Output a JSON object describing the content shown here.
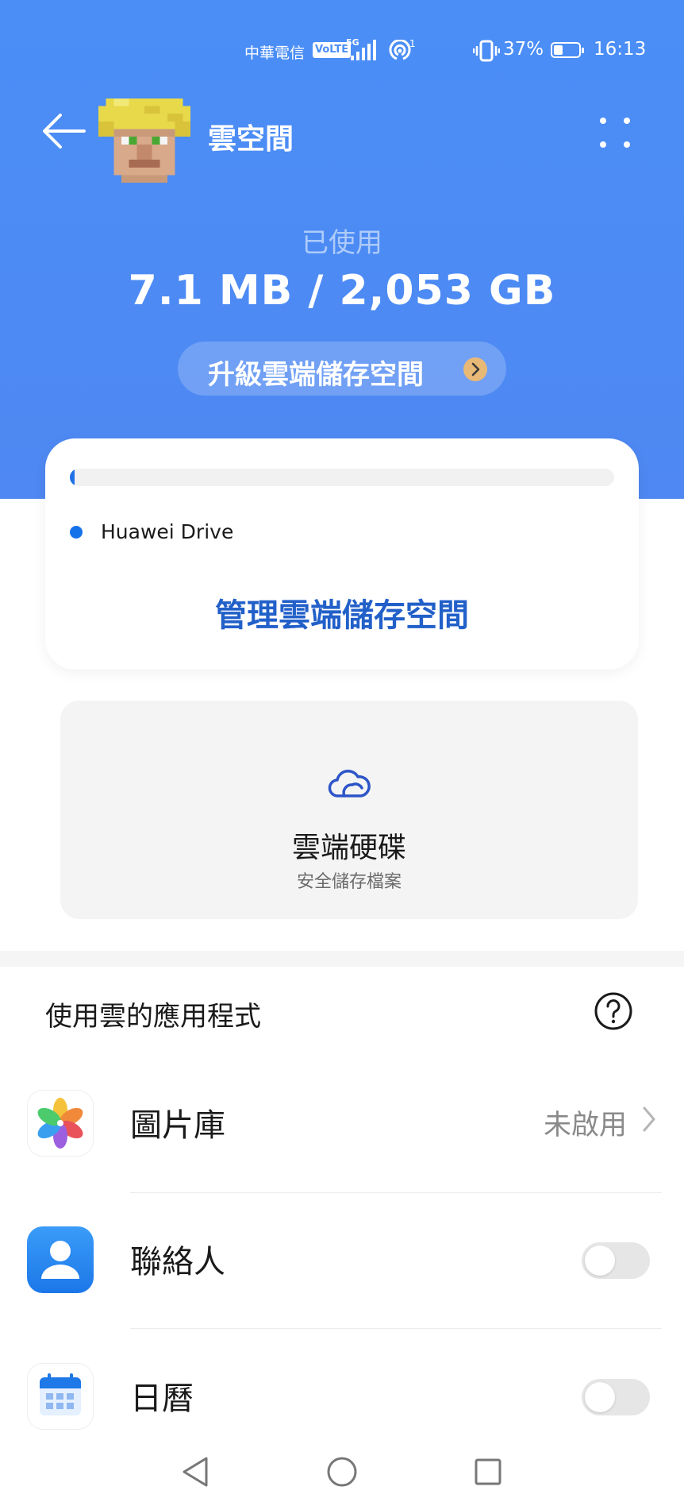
{
  "status_bar": {
    "carrier": "中華電信",
    "volte": "VoLTE",
    "network": "5G",
    "hotspot_sup": "1",
    "battery_percent": "37%",
    "battery_level": 0.37,
    "time": "16:13"
  },
  "header": {
    "title": "雲空間",
    "back_icon": "back-arrow-icon",
    "more_icon": "more-dots-icon"
  },
  "storage": {
    "used_label": "已使用",
    "used_value": "7.1 MB / 2,053 GB",
    "upgrade_label": "升級雲端儲存空間",
    "usage_fraction": 0.003,
    "legend_label": "Huawei Drive",
    "legend_color": "#1672e8",
    "manage_label": "管理雲端儲存空間"
  },
  "drive": {
    "title": "雲端硬碟",
    "subtitle": "安全儲存檔案",
    "icon": "cloud-icon"
  },
  "apps_section": {
    "title": "使用雲的應用程式",
    "help_icon": "help-icon",
    "items": [
      {
        "label": "圖片庫",
        "status": "未啟用",
        "icon": "gallery-icon"
      },
      {
        "label": "聯絡人",
        "toggle_on": false,
        "icon": "contacts-icon"
      },
      {
        "label": "日曆",
        "toggle_on": false,
        "icon": "calendar-icon"
      }
    ]
  },
  "colors": {
    "hero_blue": "#4a8ef6",
    "accent_blue": "#2260c9",
    "upgrade_badge": "#e8b877"
  }
}
